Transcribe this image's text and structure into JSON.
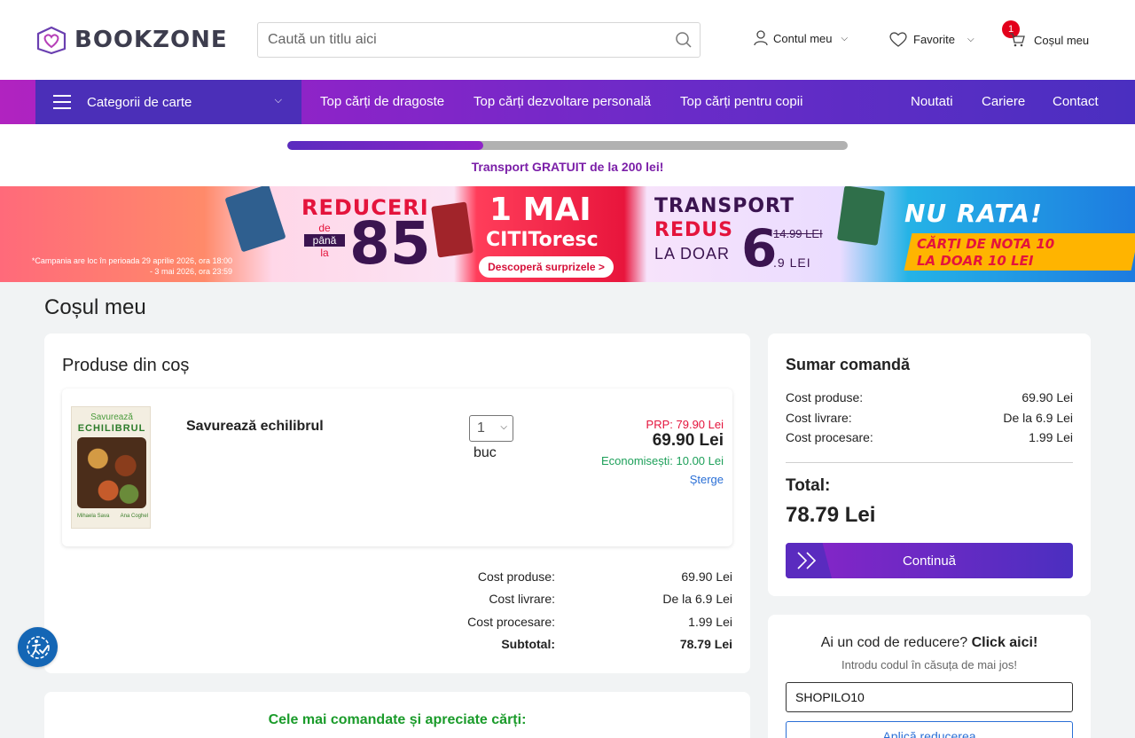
{
  "header": {
    "logo_text": "BOOKZONE",
    "search_placeholder": "Caută un titlu aici",
    "account_label": "Contul meu",
    "favorites_label": "Favorite",
    "cart_label": "Coșul meu",
    "cart_count": "1"
  },
  "nav": {
    "categories_label": "Categorii de carte",
    "links": [
      "Top cărți de dragoste",
      "Top cărți dezvoltare personală",
      "Top cărți pentru copii",
      "Noutati",
      "Cariere",
      "Contact"
    ]
  },
  "shipping": {
    "progress_fraction": 0.35,
    "text": "Transport GRATUIT de la 200 lei!"
  },
  "banner": {
    "campaign_note": "*Campania are loc în perioada 29 aprilie 2026, ora 18:00 - 3 mai 2026, ora 23:59",
    "reduceri": "REDUCERI",
    "de_pana_la": [
      "de",
      "până",
      "la"
    ],
    "big_number": "85",
    "date": "1 MAI",
    "citi": "CITIToresc",
    "cta": "Descoperă surprizele >",
    "transport": "TRANSPORT",
    "redus": "REDUS",
    "la_doar": "LA DOAR",
    "price_main": "6",
    "price_old": "14.99 LEI",
    "price_dec": ".9 LEI",
    "nu_rata": "NU RATA!",
    "nota_line1": "CĂRȚI DE NOTA 10",
    "nota_line2": "LA DOAR 10 LEI"
  },
  "page": {
    "title": "Coșul meu"
  },
  "products": {
    "title": "Produse din coș",
    "item": {
      "cover_line1": "Savurează",
      "cover_line2": "ECHILIBRUL",
      "cover_authors": [
        "Mihaela Sava",
        "Ana Coghel"
      ],
      "name": "Savurează echilibrul",
      "qty": "1",
      "unit": "buc",
      "prp": "PRP: 79.90 Lei",
      "price": "69.90 Lei",
      "savings": "Economisești: 10.00 Lei",
      "delete_label": "Șterge"
    },
    "totals": [
      {
        "label": "Cost produse:",
        "value": "69.90 Lei"
      },
      {
        "label": "Cost livrare:",
        "value": "De la 6.9 Lei"
      },
      {
        "label": "Cost procesare:",
        "value": "1.99 Lei"
      },
      {
        "label": "Subtotal:",
        "value": "78.79 Lei"
      }
    ]
  },
  "summary": {
    "title": "Sumar comandă",
    "rows": [
      {
        "label": "Cost produse:",
        "value": "69.90 Lei"
      },
      {
        "label": "Cost livrare:",
        "value": "De la 6.9 Lei"
      },
      {
        "label": "Cost procesare:",
        "value": "1.99 Lei"
      }
    ],
    "total_label": "Total:",
    "total_value": "78.79 Lei",
    "continue_label": "Continuă"
  },
  "coupon": {
    "question": "Ai un cod de reducere?",
    "question_link": "Click aici!",
    "hint": "Introdu codul în căsuța de mai jos!",
    "value": "SHOPILO10",
    "apply_label": "Aplică reducerea"
  },
  "bottom": {
    "title": "Cele mai comandate și apreciate cărți:"
  },
  "icons": {
    "logo": "book-heart-icon",
    "search": "search-icon",
    "account": "user-icon",
    "favorites": "heart-icon",
    "cart": "cart-icon",
    "menu": "hamburger-icon",
    "accessibility": "accessibility-icon"
  },
  "colors": {
    "brand_purple": "#6a2bc8",
    "nav_dark": "#4b2fb8",
    "shipping_text": "#7b1fa8",
    "prp_red": "#e4143c",
    "savings_green": "#1ea05a",
    "link_blue": "#2a6fd6",
    "badge_red": "#e3001b"
  }
}
